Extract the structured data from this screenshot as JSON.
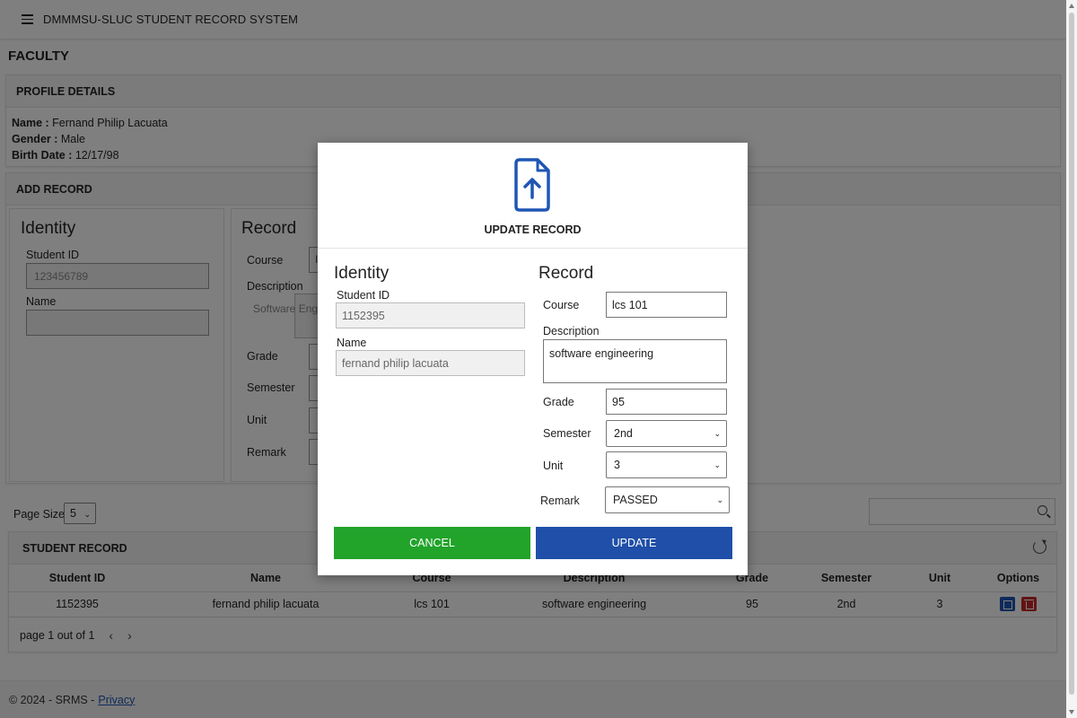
{
  "app": {
    "title": "DMMMSU-SLUC STUDENT RECORD SYSTEM"
  },
  "page": {
    "heading": "FACULTY"
  },
  "profile": {
    "header": "PROFILE DETAILS",
    "name_label": "Name :",
    "name_value": "Fernand Philip Lacuata",
    "gender_label": "Gender :",
    "gender_value": "Male",
    "birth_label": "Birth Date :",
    "birth_value": "12/17/98"
  },
  "add_record": {
    "header": "ADD RECORD",
    "identity_title": "Identity",
    "student_id_label": "Student ID",
    "student_id_placeholder": "123456789",
    "name_label": "Name",
    "record_title": "Record",
    "course_label": "Course",
    "course_partial": "I",
    "description_label": "Description",
    "description_partial": "Software Engi",
    "grade_label": "Grade",
    "semester_label": "Semester",
    "unit_label": "Unit",
    "remark_label": "Remark"
  },
  "list_controls": {
    "page_size_label": "Page Size",
    "page_size_value": "5"
  },
  "student_record": {
    "header": "STUDENT RECORD",
    "columns": [
      "Student ID",
      "Name",
      "Course",
      "Description",
      "Grade",
      "Semester",
      "Unit",
      "Options"
    ],
    "rows": [
      [
        "1152395",
        "fernand philip lacuata",
        "lcs 101",
        "software engineering",
        "95",
        "2nd",
        "3"
      ]
    ],
    "pager_text": "page 1 out of 1"
  },
  "footer": {
    "copyright": "© 2024 - SRMS -",
    "privacy_link": "Privacy"
  },
  "modal": {
    "title": "UPDATE RECORD",
    "identity_title": "Identity",
    "student_id_label": "Student ID",
    "student_id_value": "1152395",
    "name_label": "Name",
    "name_value": "fernand philip lacuata",
    "record_title": "Record",
    "course_label": "Course",
    "course_value": "lcs 101",
    "description_label": "Description",
    "description_value": "software engineering",
    "grade_label": "Grade",
    "grade_value": "95",
    "semester_label": "Semester",
    "semester_value": "2nd",
    "unit_label": "Unit",
    "unit_value": "3",
    "remark_label": "Remark",
    "remark_value": "PASSED",
    "cancel_label": "CANCEL",
    "update_label": "UPDATE"
  },
  "colors": {
    "cancel": "#22a32a",
    "update": "#1f4fa8",
    "icon_blue": "#1f56b5",
    "delete": "#c62828"
  }
}
